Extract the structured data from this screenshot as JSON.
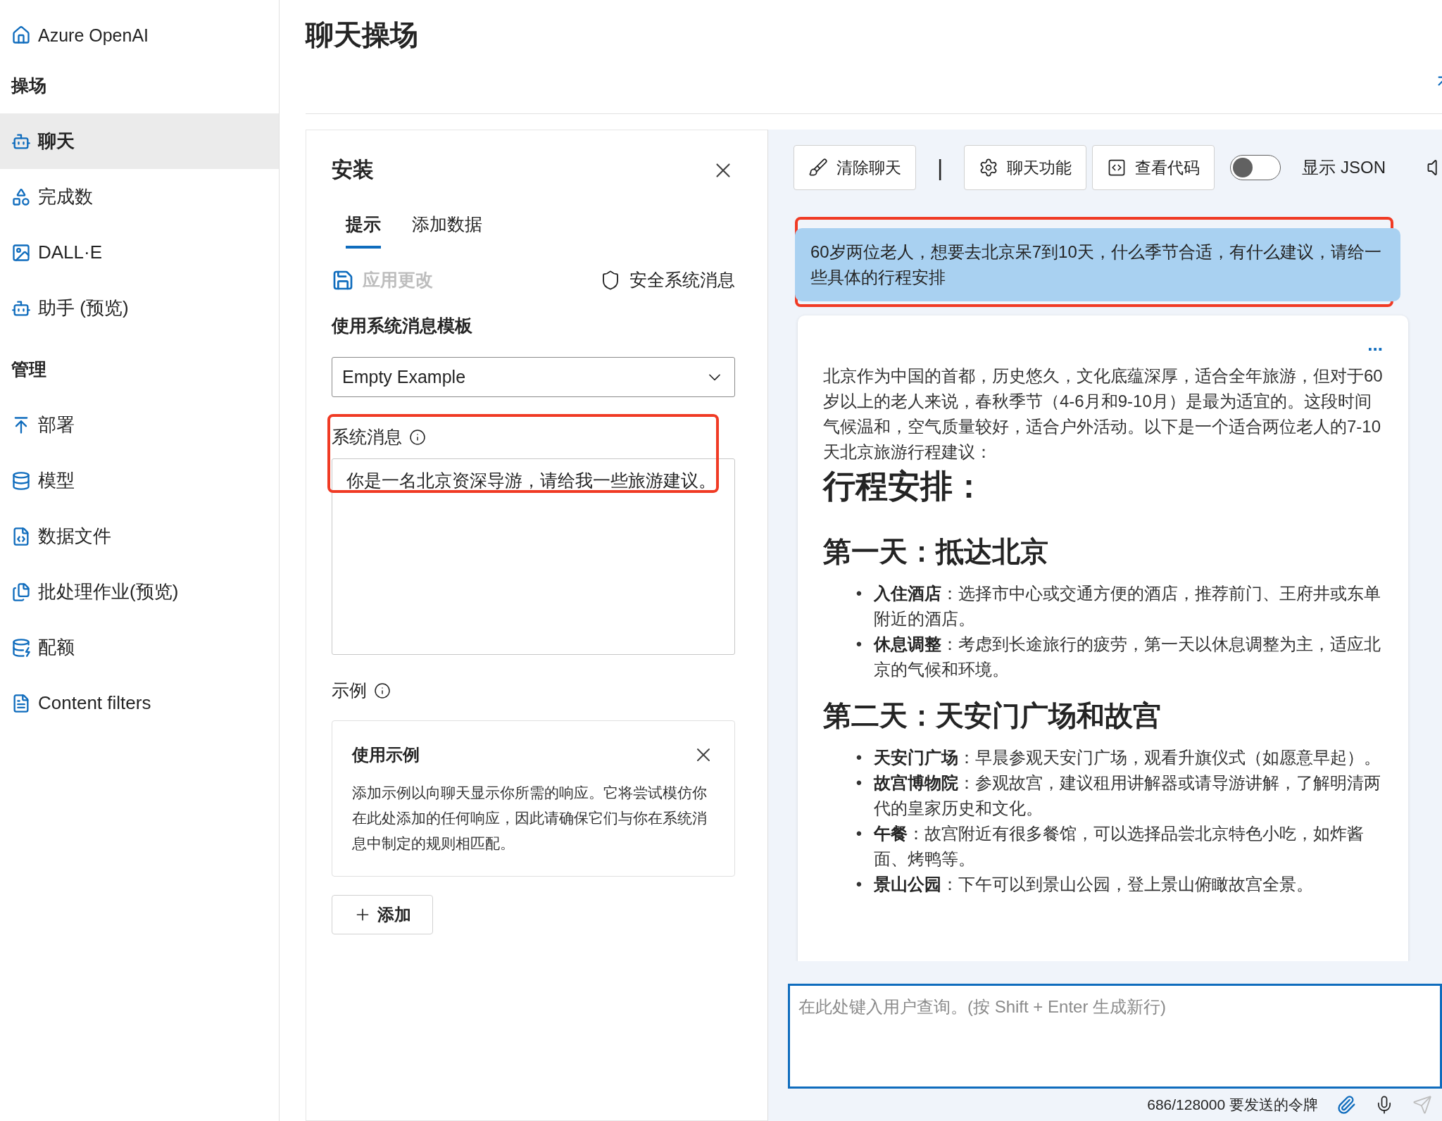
{
  "sidebar": {
    "brand": "Azure OpenAI",
    "sections": [
      {
        "heading": "操场",
        "items": [
          {
            "label": "聊天",
            "selected": true
          },
          {
            "label": "完成数",
            "selected": false
          },
          {
            "label": "DALL·E",
            "selected": false
          },
          {
            "label": "助手 (预览)",
            "selected": false
          }
        ]
      },
      {
        "heading": "管理",
        "items": [
          {
            "label": "部署",
            "selected": false
          },
          {
            "label": "模型",
            "selected": false
          },
          {
            "label": "数据文件",
            "selected": false
          },
          {
            "label": "批处理作业(预览)",
            "selected": false
          },
          {
            "label": "配额",
            "selected": false
          },
          {
            "label": "Content filters",
            "selected": false
          }
        ]
      }
    ]
  },
  "page_title": "聊天操场",
  "setup": {
    "title": "安装",
    "tabs": [
      {
        "label": "提示",
        "selected": true
      },
      {
        "label": "添加数据",
        "selected": false
      }
    ],
    "apply_button": {
      "label": "应用更改",
      "disabled": true
    },
    "safety_link": "安全系统消息",
    "template_label": "使用系统消息模板",
    "template_value": "Empty Example",
    "system_message": {
      "label": "系统消息",
      "value": "你是一名北京资深导游，请给我一些旅游建议。",
      "highlighted": true
    },
    "examples": {
      "label": "示例",
      "card_title": "使用示例",
      "card_text": "添加示例以向聊天显示你所需的响应。它将尝试模仿你在此处添加的任何响应，因此请确保它们与你在系统消息中制定的规则相匹配。",
      "add_button": "添加"
    }
  },
  "chat": {
    "toolbar": {
      "buttons": [
        "清除聊天",
        "聊天功能",
        "查看代码"
      ],
      "separator": "|",
      "json_toggle": {
        "label": "显示 JSON",
        "on": false
      }
    },
    "messages": [
      {
        "kind": "user",
        "highlighted": true,
        "text": "60岁两位老人，想要去北京呆7到10天，什么季节合适，有什么建议，请给一些具体的行程安排"
      },
      {
        "kind": "assistant",
        "menu": "...",
        "blocks": [
          {
            "kind": "paragraph",
            "text": "北京作为中国的首都，历史悠久，文化底蕴深厚，适合全年旅游，但对于60岁以上的老人来说，春秋季节（4-6月和9-10月）是最为适宜的。这段时间气候温和，空气质量较好，适合户外活动。以下是一个适合两位老人的7-10天北京旅游行程建议："
          },
          {
            "kind": "h1",
            "text": "行程安排："
          },
          {
            "kind": "h2",
            "text": "第一天：抵达北京"
          },
          {
            "kind": "list",
            "marker": "•",
            "items": [
              {
                "term": "入住酒店",
                "text": "：选择市中心或交通方便的酒店，推荐前门、王府井或东单附近的酒店。"
              },
              {
                "term": "休息调整",
                "text": "：考虑到长途旅行的疲劳，第一天以休息调整为主，适应北京的气候和环境。"
              }
            ]
          },
          {
            "kind": "h2",
            "text": "第二天：天安门广场和故宫"
          },
          {
            "kind": "list",
            "marker": "•",
            "items": [
              {
                "term": "天安门广场",
                "text": "：早晨参观天安门广场，观看升旗仪式（如愿意早起）。"
              },
              {
                "term": "故宫博物院",
                "text": "：参观故宫，建议租用讲解器或请导游讲解，了解明清两代的皇家历史和文化。"
              },
              {
                "term": "午餐",
                "text": "：故宫附近有很多餐馆，可以选择品尝北京特色小吃，如炸酱面、烤鸭等。"
              },
              {
                "term": "景山公园",
                "text": "：下午可以到景山公园，登上景山俯瞰故宫全景。"
              }
            ]
          }
        ]
      }
    ],
    "input": {
      "placeholder": "在此处键入用户查询。(按 Shift + Enter 生成新行)"
    },
    "token_count": "686/128000 要发送的令牌"
  }
}
